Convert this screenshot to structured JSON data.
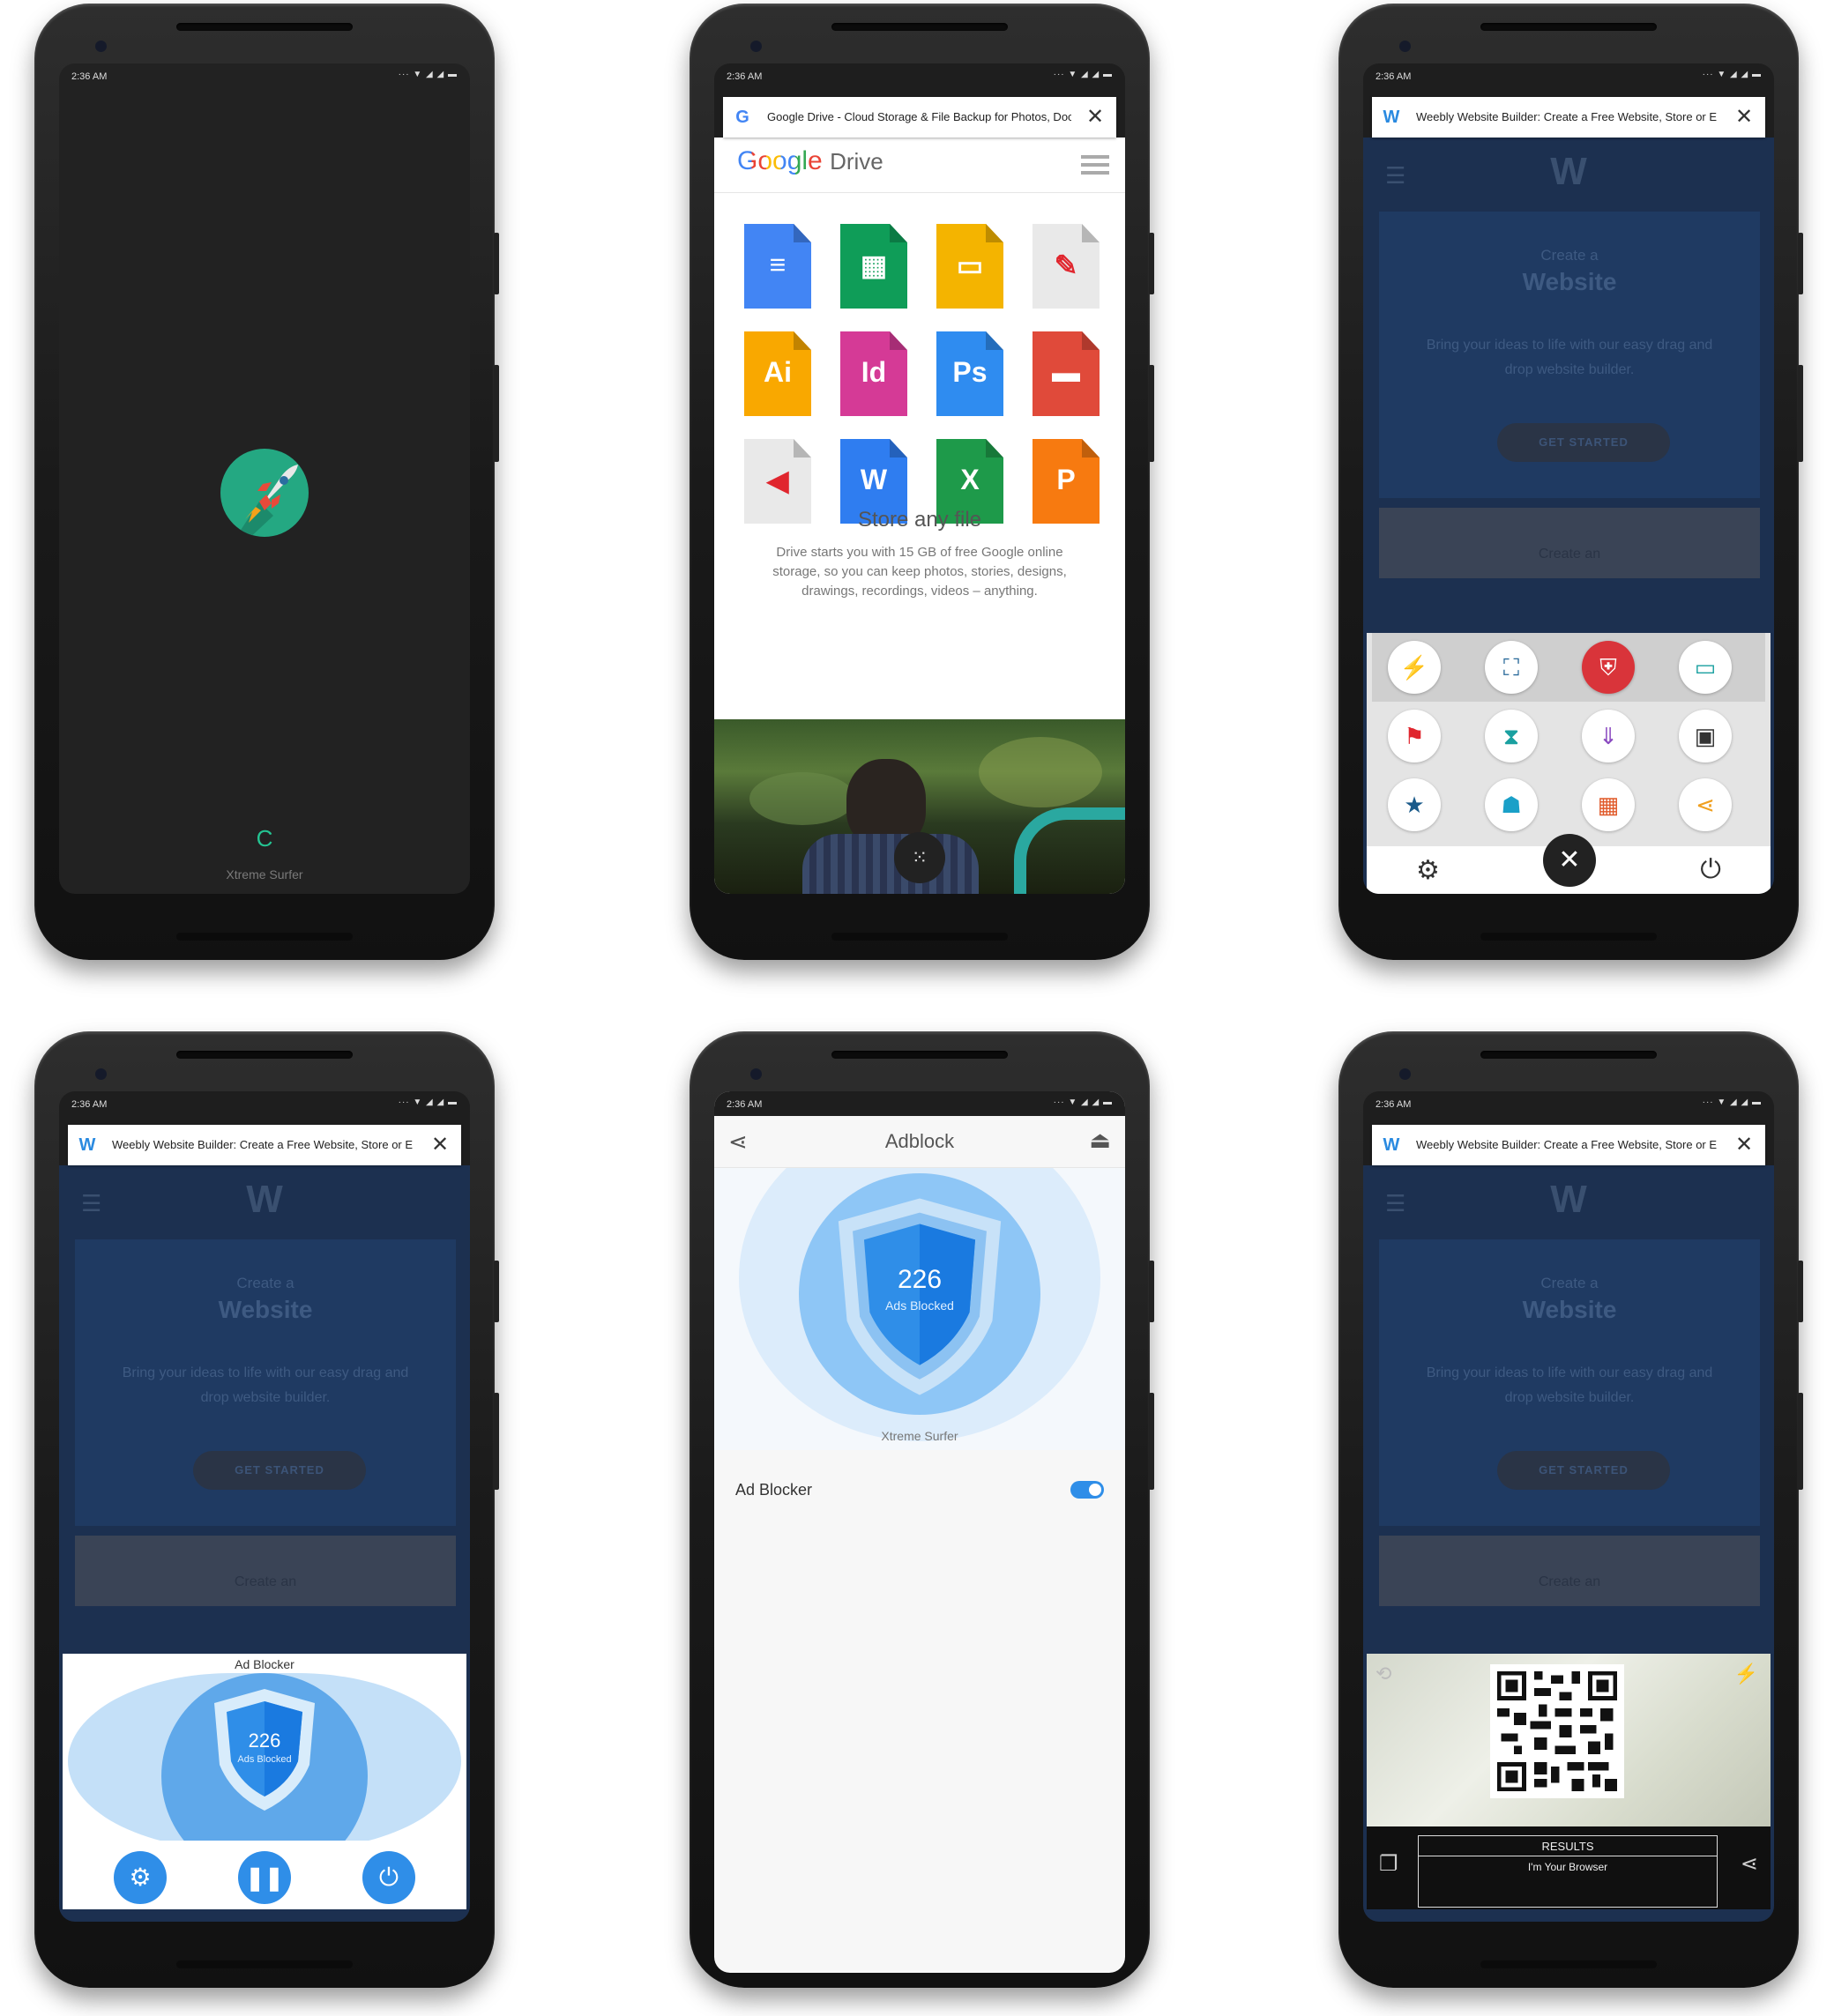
{
  "status_time": "2:36 AM",
  "status_icons": "··· ▼ ◢ ◢ ▬",
  "splash": {
    "app_name": "Xtreme Surfer",
    "spinner": "C"
  },
  "drive": {
    "tab_title": "Google Drive - Cloud Storage & File Backup for Photos, Doc",
    "logo_word": "Google",
    "logo_product": "Drive",
    "file_tiles": [
      {
        "label": "",
        "icon": "docs-icon",
        "color": "#4285f4"
      },
      {
        "label": "",
        "icon": "sheets-icon",
        "color": "#0f9d58"
      },
      {
        "label": "",
        "icon": "slides-icon",
        "color": "#f4b400"
      },
      {
        "label": "",
        "icon": "pdf-icon",
        "color": "#e9e9e9"
      },
      {
        "label": "Ai",
        "icon": "illustrator-icon",
        "color": "#f9a800"
      },
      {
        "label": "Id",
        "icon": "indesign-icon",
        "color": "#d53a96"
      },
      {
        "label": "Ps",
        "icon": "photoshop-icon",
        "color": "#2f8cf0"
      },
      {
        "label": "",
        "icon": "video-icon",
        "color": "#e04a3a"
      },
      {
        "label": "",
        "icon": "audio-icon",
        "color": "#e9e9e9"
      },
      {
        "label": "W",
        "icon": "word-icon",
        "color": "#2f7df0"
      },
      {
        "label": "X",
        "icon": "excel-icon",
        "color": "#1e9a4a"
      },
      {
        "label": "P",
        "icon": "powerpoint-icon",
        "color": "#f77a10"
      }
    ],
    "heading": "Store any file",
    "body": "Drive starts you with 15 GB of free Google online storage, so you can keep photos, stories, designs, drawings, recordings, videos – anything."
  },
  "weebly": {
    "tab_title": "Weebly Website Builder: Create a Free Website, Store or E",
    "hero_small": "Create a",
    "hero_big": "Website",
    "hero_body": "Bring your ideas to life with our easy drag and drop website builder.",
    "cta": "GET STARTED",
    "band_text": "Create an"
  },
  "tools_menu": {
    "tools": [
      "lightning-icon",
      "fullscreen-icon",
      "adblock-icon",
      "desktop-icon",
      "bookmark-icon",
      "hourglass-icon",
      "download-icon",
      "save-icon",
      "favorite-icon",
      "shirt-icon",
      "qr-icon",
      "share-icon"
    ],
    "colors": [
      "#f3a21a",
      "#2a6a9a",
      "#d9343a",
      "#1aa0a0",
      "#e0262e",
      "#1aa0a0",
      "#8a4ac0",
      "#333333",
      "#1a5a8a",
      "#1aa0c8",
      "#e05a2a",
      "#f0a020"
    ],
    "settings": "⚙",
    "close": "✕",
    "power": "⏻"
  },
  "adblock_panel": {
    "title": "Ad Blocker",
    "count": "226",
    "count_label": "Ads Blocked"
  },
  "adblock_page": {
    "title": "Adblock",
    "count": "226",
    "count_label": "Ads Blocked",
    "brand": "Xtreme Surfer",
    "toggle_label": "Ad Blocker",
    "toggle_on": true
  },
  "qr_scanner": {
    "results_title": "RESULTS",
    "result_text": "I'm Your Browser"
  }
}
